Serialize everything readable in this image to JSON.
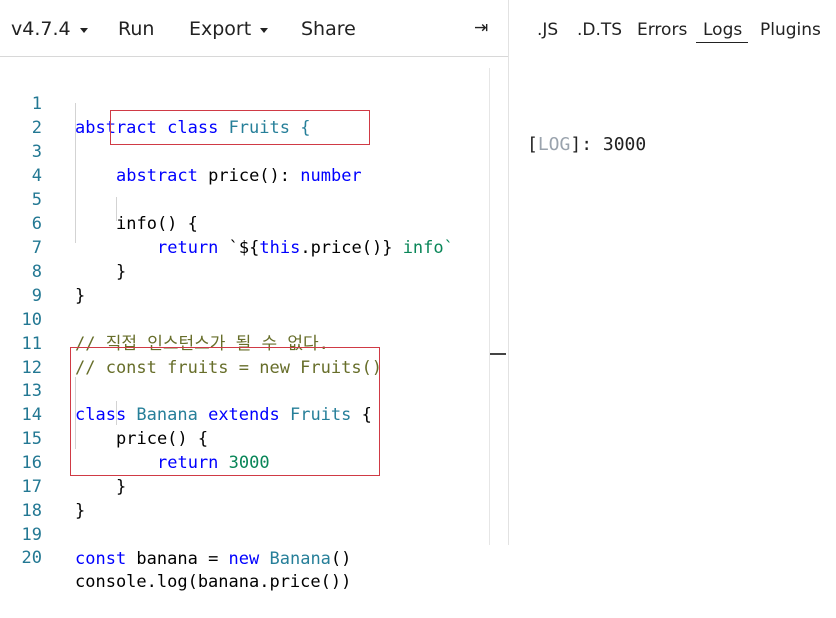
{
  "toolbar": {
    "version": "v4.7.4",
    "run": "Run",
    "export": "Export",
    "share": "Share",
    "collapse_glyph": "⇥"
  },
  "tabs": [
    ".JS",
    ".D.TS",
    "Errors",
    "Logs",
    "Plugins"
  ],
  "active_tab": "Logs",
  "line_numbers": [
    "1",
    "2",
    "3",
    "4",
    "5",
    "6",
    "7",
    "8",
    "9",
    "10",
    "11",
    "12",
    "13",
    "14",
    "15",
    "16",
    "17",
    "18",
    "19",
    "20"
  ],
  "code": {
    "l1": {
      "a": "abstract",
      "b": " ",
      "c": "class",
      "d": " Fruits {"
    },
    "l3": {
      "a": "abstract",
      "b": " price(): ",
      "c": "number"
    },
    "l5": {
      "a": "info() {"
    },
    "l6": {
      "a": "return",
      "b": " `${",
      "c": "this",
      "d": ".price()}",
      "e": " info`"
    },
    "l7": {
      "a": "}"
    },
    "l8": {
      "a": "}"
    },
    "l10": {
      "a": "// 직접 인스턴스가 될 수 없다."
    },
    "l11": {
      "a": "// const fruits = new Fruits()"
    },
    "l13": {
      "a": "class",
      "b": " Banana ",
      "c": "extends",
      "d": " Fruits",
      "e": " {"
    },
    "l14": {
      "a": "price() {"
    },
    "l15": {
      "a": "return",
      "b": " ",
      "c": "3000"
    },
    "l16": {
      "a": "}"
    },
    "l17": {
      "a": "}"
    },
    "l19": {
      "a": "const",
      "b": " banana = ",
      "c": "new",
      "d": " Banana",
      "e": "()"
    },
    "l20": {
      "a": "console.log(banana.price())"
    }
  },
  "logs": [
    {
      "open": "[",
      "tag": "LOG",
      "close": "]",
      "message": ": 3000"
    }
  ],
  "colors": {
    "keyword": "#0000ff",
    "type": "#267f99",
    "number": "#098658",
    "comment": "#008000",
    "line_number": "#237893",
    "highlight_box": "#d03a45"
  }
}
